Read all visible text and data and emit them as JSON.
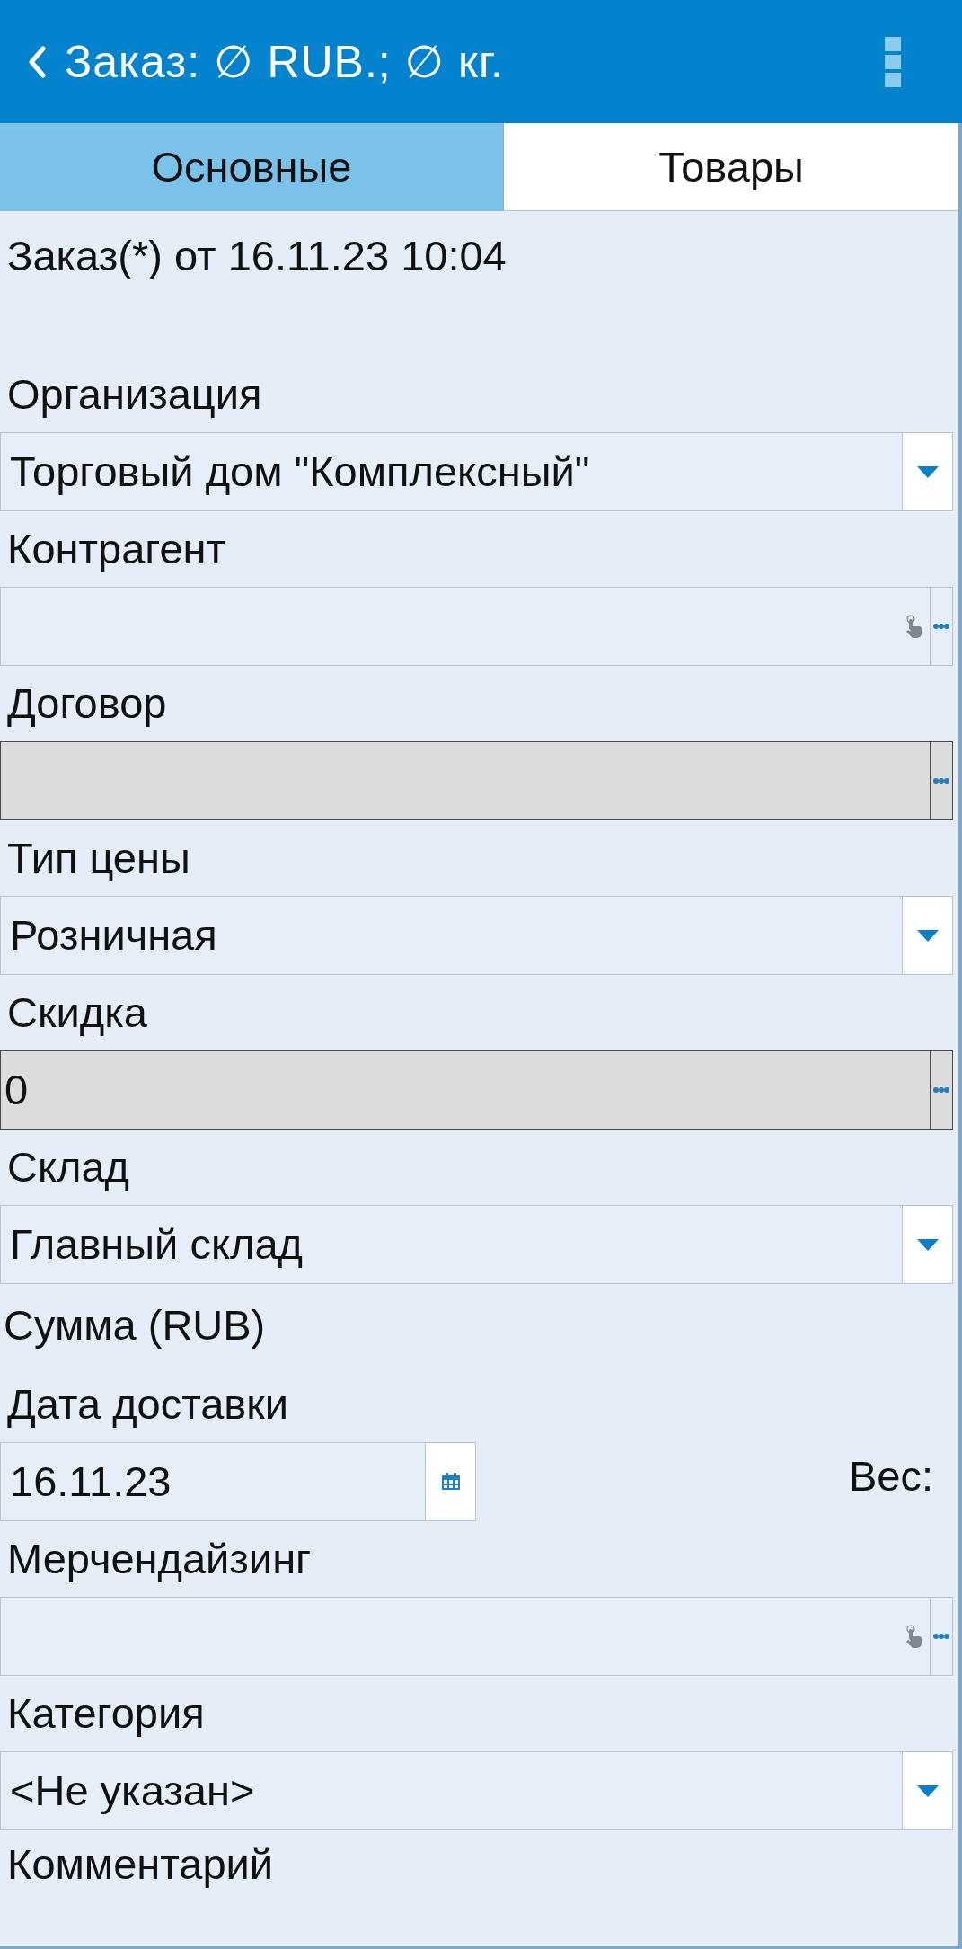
{
  "header": {
    "title": "Заказ: ∅ RUB.; ∅ кг."
  },
  "tabs": [
    {
      "label": "Основные",
      "selected": true
    },
    {
      "label": "Товары",
      "selected": false
    }
  ],
  "document_title": "Заказ(*) от 16.11.23 10:04",
  "form": [
    {
      "kind": "dropdown",
      "label": "Организация",
      "value": "Торговый дом \"Комплексный\"",
      "disabled": false
    },
    {
      "kind": "reference",
      "label": "Контрагент",
      "disabled": false
    },
    {
      "kind": "reference",
      "label": "Договор",
      "disabled": true
    },
    {
      "kind": "dropdown",
      "label": "Тип цены",
      "value": "Розничная",
      "disabled": false
    },
    {
      "kind": "reference",
      "label": "Скидка",
      "value": "0",
      "disabled": true
    },
    {
      "kind": "dropdown",
      "label": "Склад",
      "value": "Главный склад",
      "disabled": false
    },
    {
      "kind": "caption",
      "label": "Сумма (RUB)"
    },
    {
      "kind": "date",
      "label": "Дата доставки",
      "value": "16.11.23",
      "side_label": "Вес:",
      "disabled": false
    },
    {
      "kind": "reference",
      "label": "Мерчендайзинг",
      "disabled": false
    },
    {
      "kind": "dropdown",
      "label": "Категория",
      "value": "<Не указан>",
      "disabled": false
    },
    {
      "kind": "caption",
      "label": "Комментарий"
    }
  ]
}
